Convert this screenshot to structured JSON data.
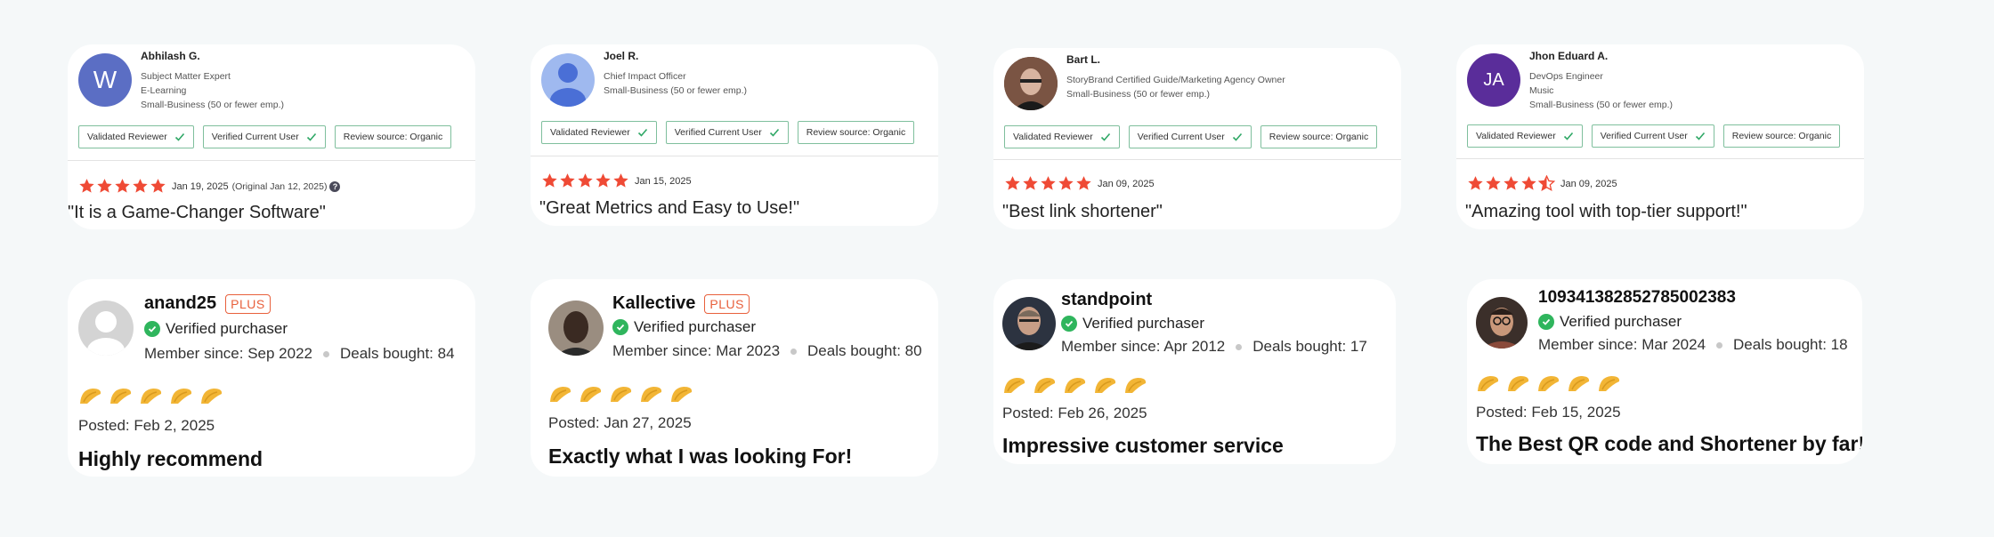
{
  "colors": {
    "background": "#f5f8f9",
    "star": "#ef4a35",
    "verified": "#2fb55d",
    "plus_badge": "#e8603c",
    "taco": "#f2b535"
  },
  "g2_reviews": [
    {
      "avatar_initials": "W",
      "avatar_color": "#5b6ec4",
      "name": "Abhilash G.",
      "meta": [
        "Subject Matter Expert",
        "E-Learning",
        "Small-Business (50 or fewer emp.)"
      ],
      "badges": [
        "Validated Reviewer",
        "Verified Current User",
        "Review source: Organic"
      ],
      "stars": 5,
      "date": "Jan 19, 2025",
      "original_date": "(Original Jan 12, 2025)",
      "title": "\"It is a Game-Changer Software\""
    },
    {
      "avatar_initials": "",
      "avatar_color": "#9fb9ef",
      "name": "Joel R.",
      "meta": [
        "Chief Impact Officer",
        "Small-Business (50 or fewer emp.)"
      ],
      "badges": [
        "Validated Reviewer",
        "Verified Current User",
        "Review source: Organic"
      ],
      "stars": 5,
      "date": "Jan 15, 2025",
      "title": "\"Great Metrics and Easy to Use!\""
    },
    {
      "avatar_initials": "",
      "avatar_color": "#6b4a3a",
      "name": "Bart L.",
      "meta": [
        "StoryBrand Certified Guide/Marketing Agency Owner",
        "Small-Business (50 or fewer emp.)"
      ],
      "badges": [
        "Validated Reviewer",
        "Verified Current User",
        "Review source: Organic"
      ],
      "stars": 5,
      "date": "Jan 09, 2025",
      "title": "\"Best link shortener\""
    },
    {
      "avatar_initials": "JA",
      "avatar_color": "#5a2d9a",
      "name": "Jhon Eduard A.",
      "meta": [
        "DevOps Engineer",
        "Music",
        "Small-Business (50 or fewer emp.)"
      ],
      "badges": [
        "Validated Reviewer",
        "Verified Current User",
        "Review source: Organic"
      ],
      "stars": 4.5,
      "date": "Jan 09, 2025",
      "title": "\"Amazing tool with top-tier support!\""
    }
  ],
  "appsumo_reviews": [
    {
      "username": "anand25",
      "plus": "PLUS",
      "verified": "Verified purchaser",
      "member_since": "Member since: Sep 2022",
      "deals": "Deals bought: 84",
      "tacos": 5,
      "posted": "Posted: Feb 2, 2025",
      "title": "Highly recommend"
    },
    {
      "username": "Kallective",
      "plus": "PLUS",
      "verified": "Verified purchaser",
      "member_since": "Member since: Mar 2023",
      "deals": "Deals bought: 80",
      "tacos": 5,
      "posted": "Posted: Jan 27, 2025",
      "title": "Exactly what I was looking For!"
    },
    {
      "username": "standpoint",
      "verified": "Verified purchaser",
      "member_since": "Member since: Apr 2012",
      "deals": "Deals bought: 17",
      "tacos": 5,
      "posted": "Posted: Feb 26, 2025",
      "title": "Impressive customer service"
    },
    {
      "username": "109341382852785002383",
      "verified": "Verified purchaser",
      "member_since": "Member since: Mar 2024",
      "deals": "Deals bought: 18",
      "tacos": 5,
      "posted": "Posted: Feb 15, 2025",
      "title": "The Best QR code and Shortener by far!"
    }
  ]
}
